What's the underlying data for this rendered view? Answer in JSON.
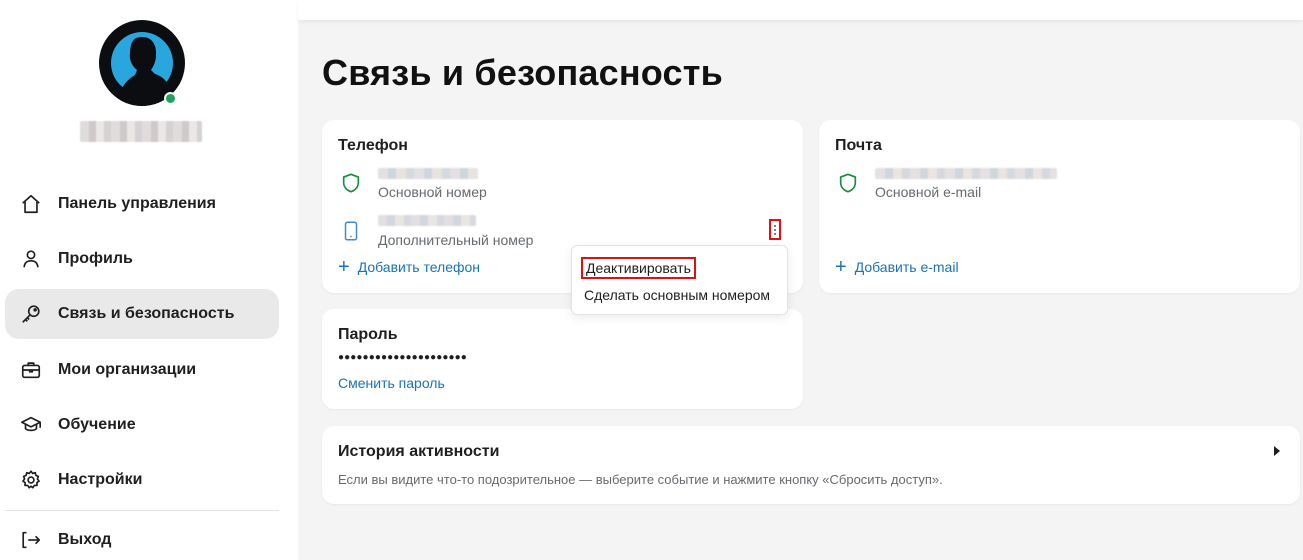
{
  "sidebar": {
    "items": [
      {
        "label": "Панель управления",
        "icon": "home-icon"
      },
      {
        "label": "Профиль",
        "icon": "user-icon"
      },
      {
        "label": "Связь и безопасность",
        "icon": "key-icon",
        "active": true
      },
      {
        "label": "Мои организации",
        "icon": "briefcase-icon"
      },
      {
        "label": "Обучение",
        "icon": "graduation-cap-icon"
      },
      {
        "label": "Настройки",
        "icon": "gear-icon"
      },
      {
        "label": "Выход",
        "icon": "logout-icon"
      }
    ],
    "status": "online"
  },
  "main": {
    "title": "Связь и безопасность",
    "phone_card": {
      "title": "Телефон",
      "primary_label": "Основной номер",
      "secondary_label": "Дополнительный номер",
      "add_link": "Добавить телефон"
    },
    "email_card": {
      "title": "Почта",
      "primary_label": "Основной e-mail",
      "add_link": "Добавить e-mail"
    },
    "context_menu": {
      "items": [
        "Деактивировать",
        "Сделать основным номером"
      ]
    },
    "password_card": {
      "title": "Пароль",
      "masked_value": "●●●●●●●●●●●●●●●●●●●●●",
      "change_link": "Сменить пароль"
    },
    "history_card": {
      "title": "История активности",
      "description": "Если вы видите что-то подозрительное — выберите событие и нажмите кнопку «Сбросить доступ»."
    }
  },
  "colors": {
    "accent_link": "#1a73b8",
    "shield_green": "#1a8a3c",
    "status_green": "#1fa35a",
    "highlight_red": "#dd1111",
    "active_nav_bg": "#e9e9ea",
    "page_bg": "#f4f4f5"
  }
}
